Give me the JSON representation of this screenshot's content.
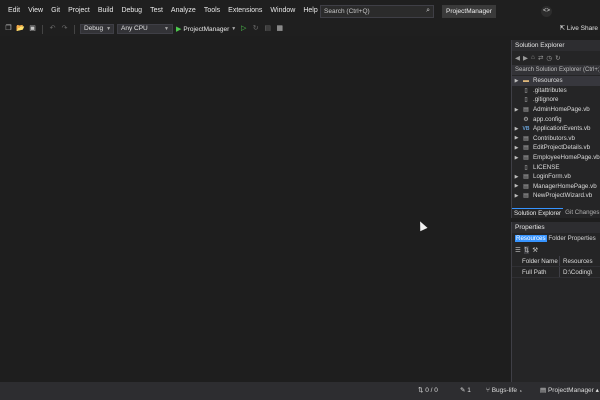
{
  "menu": {
    "items": [
      "Edit",
      "View",
      "Git",
      "Project",
      "Build",
      "Debug",
      "Test",
      "Analyze",
      "Tools",
      "Extensions",
      "Window",
      "Help"
    ],
    "search_placeholder": "Search (Ctrl+Q)",
    "project_name": "ProjectManager"
  },
  "toolbar": {
    "config": "Debug",
    "platform": "Any CPU",
    "start_target": "ProjectManager",
    "live_share": "Live Share"
  },
  "solution_explorer": {
    "title": "Solution Explorer",
    "search_placeholder": "Search Solution Explorer (Ctrl+;)",
    "items": [
      {
        "label": "Resources",
        "icon": "folder-icon",
        "expandable": true,
        "selected": true
      },
      {
        "label": ".gitattributes",
        "icon": "file-icon",
        "expandable": false,
        "selected": false
      },
      {
        "label": ".gitignore",
        "icon": "file-icon",
        "expandable": false,
        "selected": false
      },
      {
        "label": "AdminHomePage.vb",
        "icon": "form-icon",
        "expandable": true,
        "selected": false
      },
      {
        "label": "app.config",
        "icon": "config-icon",
        "expandable": false,
        "selected": false
      },
      {
        "label": "ApplicationEvents.vb",
        "icon": "vb-icon",
        "expandable": true,
        "selected": false
      },
      {
        "label": "Contributors.vb",
        "icon": "form-icon",
        "expandable": true,
        "selected": false
      },
      {
        "label": "EditProjectDetails.vb",
        "icon": "form-icon",
        "expandable": true,
        "selected": false
      },
      {
        "label": "EmployeeHomePage.vb",
        "icon": "form-icon",
        "expandable": true,
        "selected": false
      },
      {
        "label": "LICENSE",
        "icon": "file-icon",
        "expandable": false,
        "selected": false
      },
      {
        "label": "LoginForm.vb",
        "icon": "form-icon",
        "expandable": true,
        "selected": false
      },
      {
        "label": "ManagerHomePage.vb",
        "icon": "form-icon",
        "expandable": true,
        "selected": false
      },
      {
        "label": "NewProjectWizard.vb",
        "icon": "form-icon",
        "expandable": true,
        "selected": false
      }
    ],
    "tabs": [
      "Solution Explorer",
      "Git Changes"
    ]
  },
  "properties": {
    "title": "Properties",
    "object_name": "Resources",
    "object_type": "Folder Properties",
    "rows": [
      {
        "name": "Folder Name",
        "value": "Resources"
      },
      {
        "name": "Full Path",
        "value": "D:\\Coding\\"
      }
    ]
  },
  "statusbar": {
    "changes": "0 / 0",
    "pencil_count": "1",
    "branch": "Bugs-life",
    "repo": "ProjectManager"
  }
}
